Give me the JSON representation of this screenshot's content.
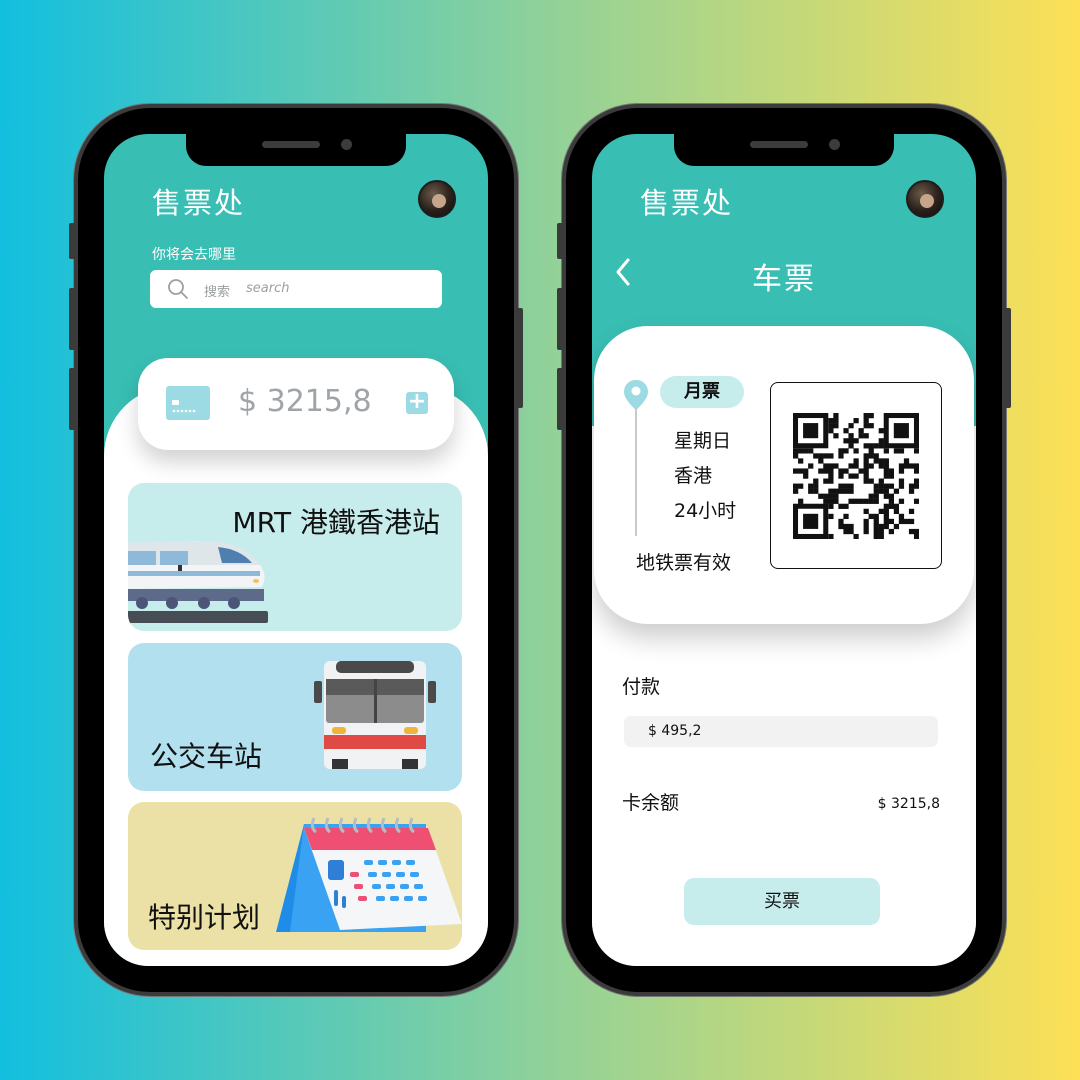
{
  "left_screen": {
    "app_title": "售票处",
    "subtitle": "你将会去哪里",
    "search": {
      "placeholder_cn": "搜索",
      "placeholder_en": "search"
    },
    "balance": {
      "amount": "$ 3215,8",
      "add_label": "+"
    },
    "tiles": [
      {
        "label": "MRT 港鐵香港站",
        "icon": "train-icon"
      },
      {
        "label": "公交车站",
        "icon": "bus-icon"
      },
      {
        "label": "特别计划",
        "icon": "calendar-icon"
      }
    ]
  },
  "right_screen": {
    "app_title": "售票处",
    "page_title": "车票",
    "ticket": {
      "type": "月票",
      "day": "星期日",
      "location": "香港",
      "duration": "24小时",
      "note": "地铁票有效"
    },
    "payment_label": "付款",
    "payment_amount": "$ 495,2",
    "balance_label": "卡余额",
    "balance_amount": "$ 3215,8",
    "buy_label": "买票"
  },
  "colors": {
    "header_teal": "#39beb4",
    "tile_mint": "#c7ecec",
    "tile_blue": "#b2e0ef",
    "tile_yellow": "#ebe0a5"
  }
}
